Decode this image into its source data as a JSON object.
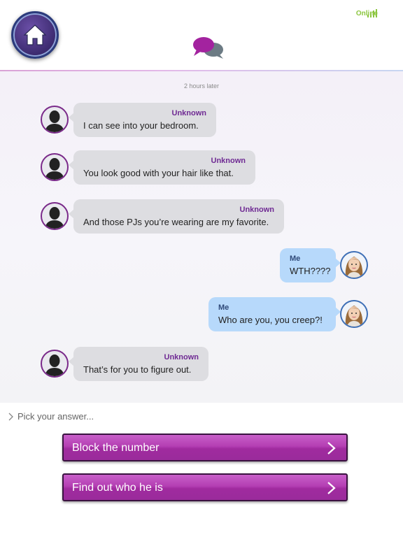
{
  "header": {
    "status": "Online",
    "home_icon": "home-icon",
    "chat_icon": "chat-bubbles-icon",
    "signal_icon": "signal-bars-icon"
  },
  "chat": {
    "time_note": "2 hours later",
    "messages": [
      {
        "from": "Unknown",
        "text": "I can see into your bedroom.",
        "side": "in"
      },
      {
        "from": "Unknown",
        "text": "You look good with your hair like that.",
        "side": "in"
      },
      {
        "from": "Unknown",
        "text": "And those PJs you’re wearing are my favorite.",
        "side": "in"
      },
      {
        "from": "Me",
        "text": "WTH????",
        "side": "out"
      },
      {
        "from": "Me",
        "text": "Who are you, you creep?!",
        "side": "out"
      },
      {
        "from": "Unknown",
        "text": "That’s for you to figure out.",
        "side": "in"
      }
    ]
  },
  "answers": {
    "prompt": "Pick your answer...",
    "options": [
      {
        "label": "Block the number"
      },
      {
        "label": "Find out who he is"
      }
    ]
  },
  "colors": {
    "accent": "#b43eb3",
    "online": "#8cc63f",
    "incoming_bubble": "#dddde1",
    "outgoing_bubble": "#b7d9fb"
  }
}
